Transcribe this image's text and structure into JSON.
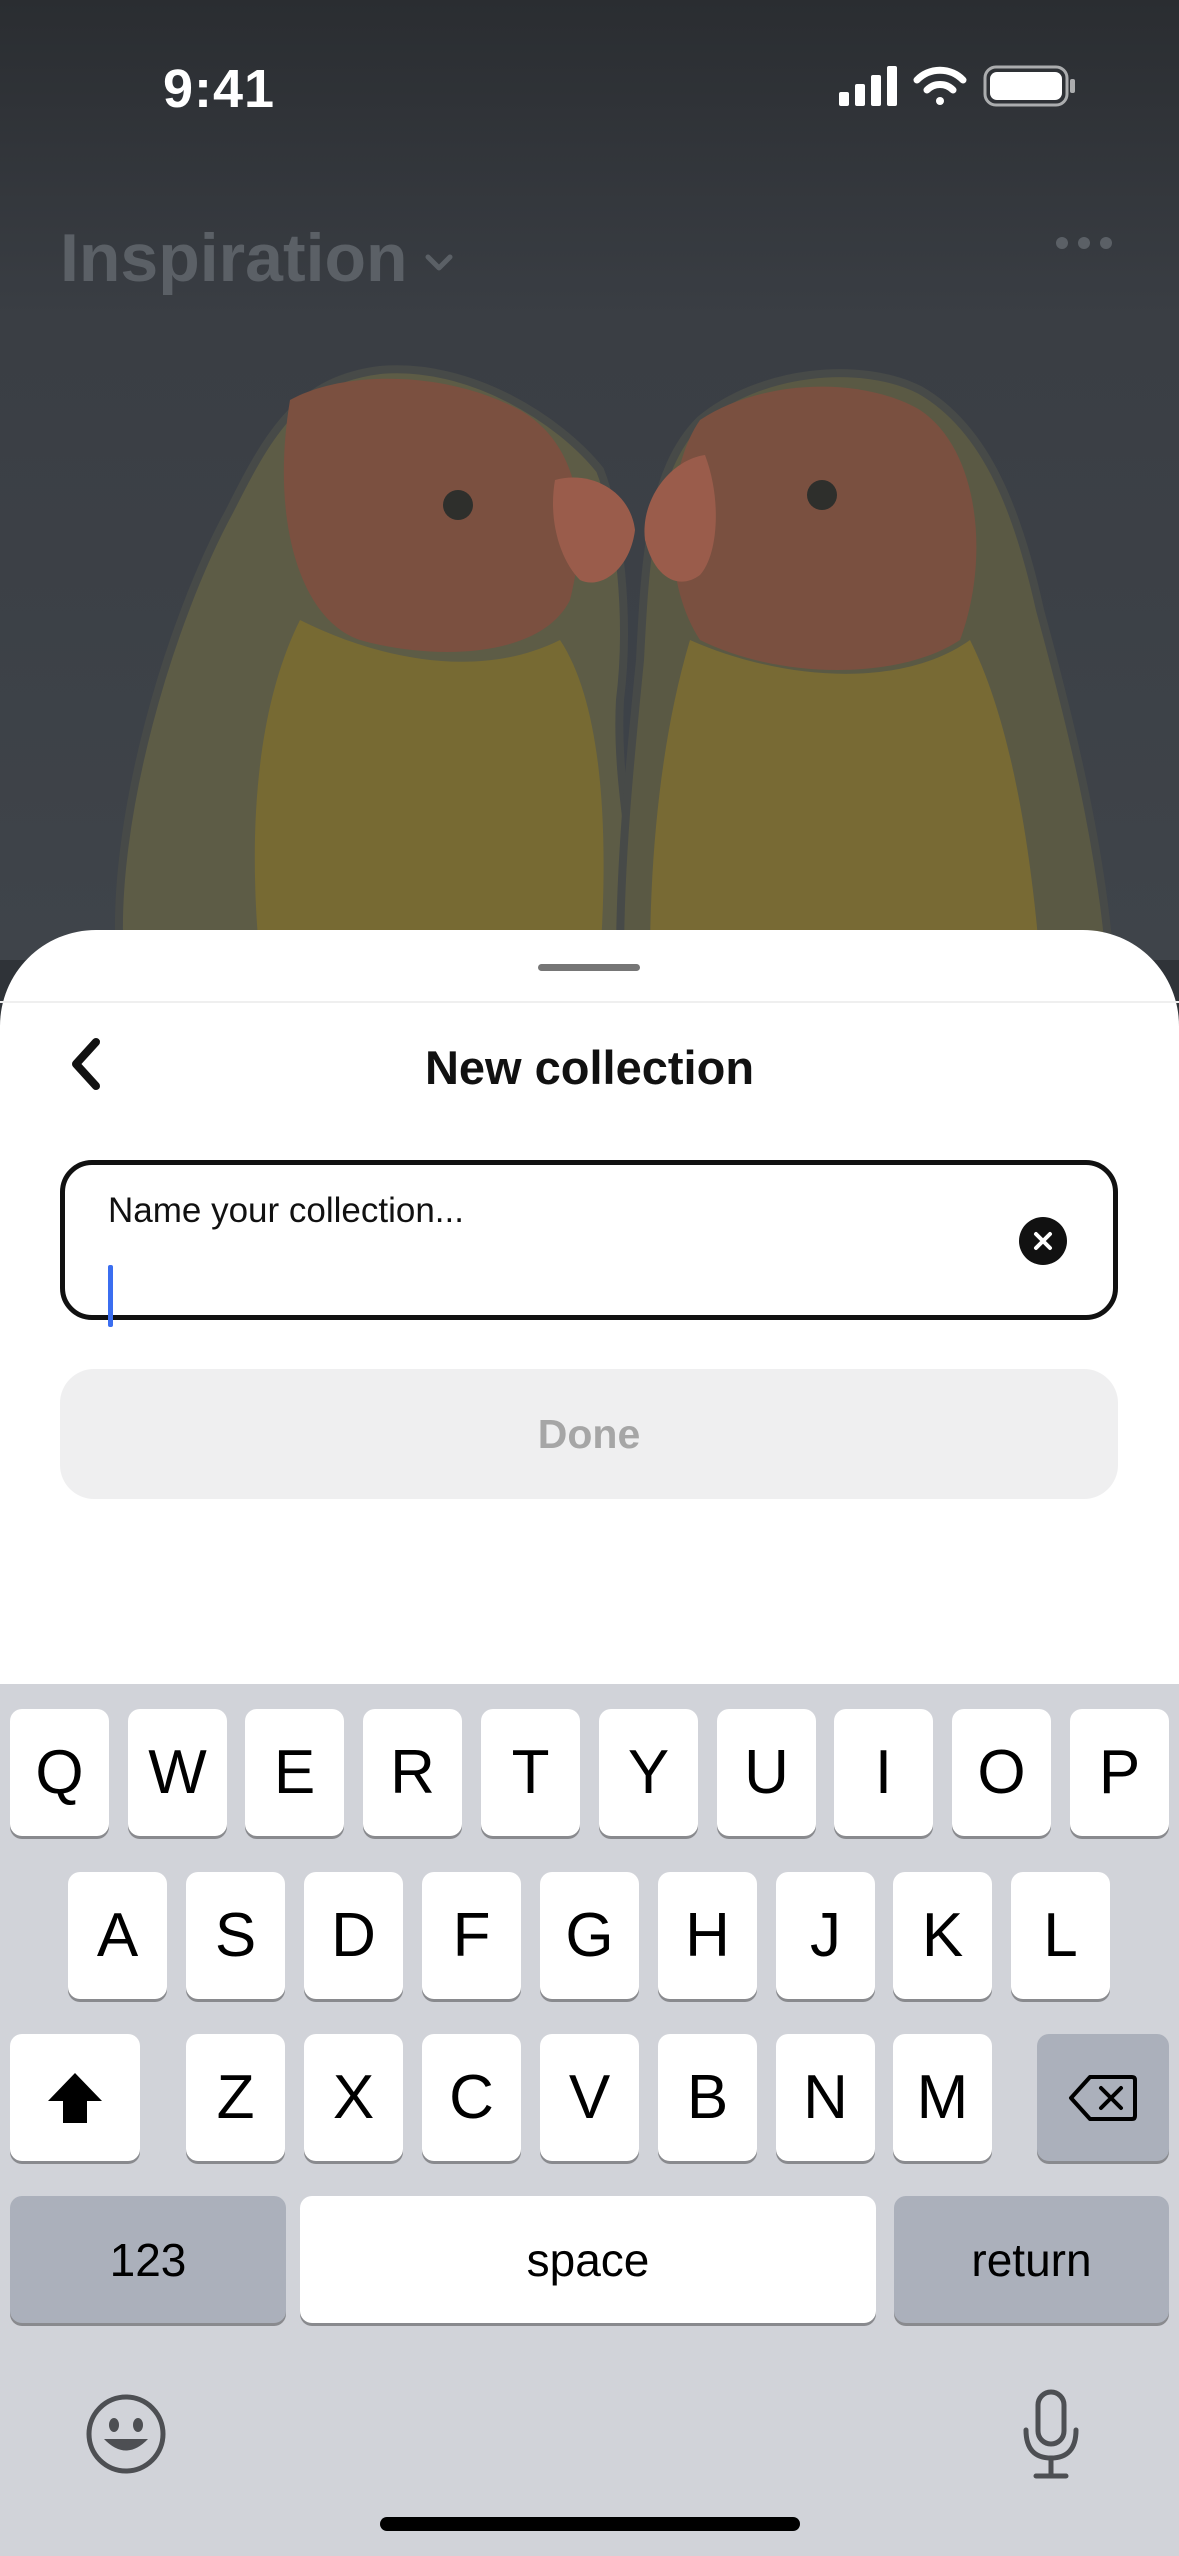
{
  "status_bar": {
    "time": "9:41"
  },
  "board": {
    "title": "Inspiration"
  },
  "sheet": {
    "title": "New collection",
    "name_field": {
      "label": "Name your collection...",
      "value": ""
    },
    "done_label": "Done"
  },
  "keyboard": {
    "row1": [
      "Q",
      "W",
      "E",
      "R",
      "T",
      "Y",
      "U",
      "I",
      "O",
      "P"
    ],
    "row2": [
      "A",
      "S",
      "D",
      "F",
      "G",
      "H",
      "J",
      "K",
      "L"
    ],
    "row3": [
      "Z",
      "X",
      "C",
      "V",
      "B",
      "N",
      "M"
    ],
    "numbers_label": "123",
    "space_label": "space",
    "return_label": "return"
  },
  "icons": {
    "status": [
      "cellular-signal-icon",
      "wifi-icon",
      "battery-icon"
    ],
    "board": [
      "chevron-down-icon",
      "more-icon"
    ],
    "sheet": [
      "back-arrow-icon",
      "clear-text-icon"
    ],
    "keyboard": [
      "shift-icon",
      "backspace-icon",
      "emoji-icon",
      "microphone-icon"
    ]
  },
  "colors": {
    "caret": "#3b6ef0",
    "done_disabled_bg": "#efeff0",
    "keyboard_bg": "#d1d3d9"
  }
}
